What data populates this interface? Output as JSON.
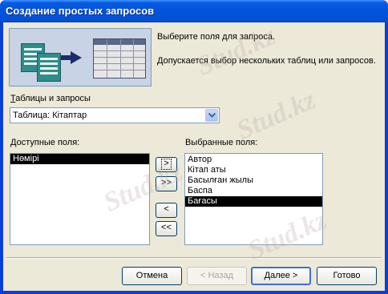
{
  "window": {
    "title": "Создание простых запросов"
  },
  "header": {
    "hint_select_fields": "Выберите поля для запроса.",
    "hint_multiple": "Допускается выбор нескольких таблиц или запросов."
  },
  "source": {
    "label_accel": "Т",
    "label_rest": "аблицы и запросы",
    "selected": "Таблица: Кітаптар"
  },
  "available": {
    "label_accel": "Д",
    "label_rest": "оступные поля:",
    "items": [
      "Нөмірі"
    ]
  },
  "selected_fields": {
    "label": "Выбранные поля:",
    "items": [
      "Автор",
      "Кітап аты",
      "Басылған жылы",
      "Баспа",
      "Бағасы"
    ]
  },
  "move_buttons": {
    "add_one": ">",
    "add_all": ">>",
    "remove_one": "<",
    "remove_all": "<<"
  },
  "footer": {
    "cancel": "Отмена",
    "back": "< Назад",
    "next": "Далее >",
    "finish": "Готово"
  },
  "watermark": "Stud.kz",
  "colors": {
    "titlebar": "#0453dd",
    "client_bg": "#ece9d8",
    "selection": "#000000"
  }
}
